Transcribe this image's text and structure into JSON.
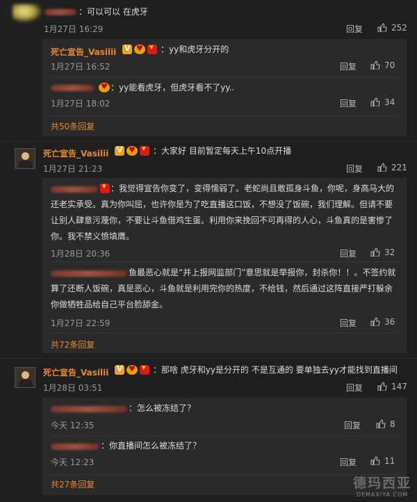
{
  "comments": [
    {
      "text": "：可以可以  在虎牙",
      "time": "1月27日 16:29",
      "reply": "回复",
      "likes": "252"
    },
    {
      "name": "死亡宣告_Vasilii",
      "text": "：大家好 目前暂定每天上午10点开播",
      "time": "1月27日 21:23",
      "reply": "回复",
      "likes": "221"
    },
    {
      "name": "死亡宣告_Vasilii",
      "text": "：那啥 虎牙和yy是分开的 不是互通的 要单独去yy才能找到直播间",
      "time": "1月28日 03:51",
      "reply": "回复",
      "likes": "147"
    }
  ],
  "replies1": [
    {
      "name": "死亡宣告_Vasilii",
      "text": "：yy和虎牙分开的",
      "time": "1月27日 16:52",
      "reply": "回复",
      "likes": "70"
    },
    {
      "text": "：yy能看虎牙，但虎牙看不了yy..",
      "time": "1月27日 18:02",
      "reply": "回复",
      "likes": "34"
    }
  ],
  "more1": "共50条回复",
  "replies2": [
    {
      "line1": "：我觉得宣告你变了，变得懦弱了。老蛇尚且敢孤身斗鱼，你呢，身高马大的",
      "line2": "还老实承受。真为你叫屈，也许你是为了吃直播这口饭，不想没了饭碗，我们理解。但请不要",
      "line3": "让别人肆意污蔑你，不要让斗鱼借鸡生蛋。利用你来挽回不可再得的人心，斗鱼真的是害惨了",
      "line4": "你。我不禁义愤填膺。",
      "time": "1月28日 20:36",
      "reply": "回复",
      "likes": "32"
    },
    {
      "line1": "鱼最恶心就是“并上报网监部门”意思就是举报你，封杀你！！。不签约就",
      "line2": "算了还断人饭碗，真是恶心，斗鱼就是利用完你的热度，不给钱，然后通过这阵直接严打躲余",
      "line3": "你做牺牲品给自己平台脸舔金。",
      "time": "1月27日 22:59",
      "reply": "回复",
      "likes": "36"
    }
  ],
  "more2": "共72条回复",
  "replies3": [
    {
      "text": "：怎么被冻结了？",
      "time": "今天 12:35",
      "reply": "回复",
      "likes": "8"
    },
    {
      "text": "：你直播间怎么被冻结了？",
      "time": "今天 12:23",
      "reply": "回复",
      "likes": "11"
    }
  ],
  "more3": "共27条回复",
  "watermark": {
    "big": "德玛西亚",
    "small": "DEMAXIYA.COM"
  }
}
